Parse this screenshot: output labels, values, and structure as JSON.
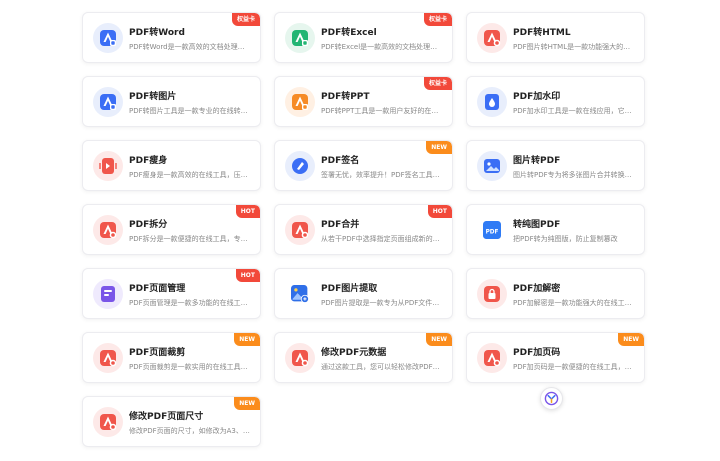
{
  "tools": [
    {
      "title": "PDF转Word",
      "desc": "PDF转Word是一款高效的文档处理…",
      "badge": "权益卡",
      "badge_color": "red",
      "icon": "pdf-to-word-icon",
      "bg": "#e8eefc",
      "fg": "#3b6ef5"
    },
    {
      "title": "PDF转Excel",
      "desc": "PDF转Excel是一款高效的文档处理…",
      "badge": "权益卡",
      "badge_color": "red",
      "icon": "pdf-to-excel-icon",
      "bg": "#e6f6ee",
      "fg": "#22b573"
    },
    {
      "title": "PDF转HTML",
      "desc": "PDF图片转HTML是一款功能强大的…",
      "badge": "",
      "badge_color": "",
      "icon": "pdf-to-html-icon",
      "bg": "#fde9e8",
      "fg": "#f0564b"
    },
    {
      "title": "PDF转图片",
      "desc": "PDF转图片工具是一款专业的在线转…",
      "badge": "",
      "badge_color": "",
      "icon": "pdf-to-image-icon",
      "bg": "#e8eefc",
      "fg": "#3b6ef5"
    },
    {
      "title": "PDF转PPT",
      "desc": "PDF转PPT工具是一款用户友好的在…",
      "badge": "权益卡",
      "badge_color": "red",
      "icon": "pdf-to-ppt-icon",
      "bg": "#fff0e3",
      "fg": "#f68b26"
    },
    {
      "title": "PDF加水印",
      "desc": "PDF加水印工具是一款在线应用，它…",
      "badge": "",
      "badge_color": "",
      "icon": "watermark-icon",
      "bg": "#e8eefc",
      "fg": "#3b6ef5"
    },
    {
      "title": "PDF瘦身",
      "desc": "PDF瘦身是一款高效的在线工具，压…",
      "badge": "",
      "badge_color": "",
      "icon": "compress-icon",
      "bg": "#fde9e8",
      "fg": "#f0564b"
    },
    {
      "title": "PDF签名",
      "desc": "签署无忧，效率提升！PDF签名工具…",
      "badge": "NEW",
      "badge_color": "orange",
      "icon": "signature-icon",
      "bg": "#e8eefc",
      "fg": "#3b6ef5"
    },
    {
      "title": "图片转PDF",
      "desc": "图片转PDF专为将多张图片合并转换…",
      "badge": "",
      "badge_color": "",
      "icon": "image-to-pdf-icon",
      "bg": "#e8eefc",
      "fg": "#3b6ef5"
    },
    {
      "title": "PDF拆分",
      "desc": "PDF拆分是一款便捷的在线工具，专…",
      "badge": "HOT",
      "badge_color": "red",
      "icon": "split-icon",
      "bg": "#fde9e8",
      "fg": "#f0564b"
    },
    {
      "title": "PDF合并",
      "desc": "从若干PDF中选择指定页面组成新的…",
      "badge": "HOT",
      "badge_color": "red",
      "icon": "merge-icon",
      "bg": "#fde9e8",
      "fg": "#f0564b"
    },
    {
      "title": "转纯图PDF",
      "desc": "把PDF转为纯图版，防止复制篡改",
      "badge": "",
      "badge_color": "",
      "icon": "pure-image-pdf-icon",
      "bg": "#ffffff",
      "fg": "#3b6ef5"
    },
    {
      "title": "PDF页面管理",
      "desc": "PDF页面管理是一款多功能的在线工…",
      "badge": "HOT",
      "badge_color": "red",
      "icon": "page-manage-icon",
      "bg": "#efeafd",
      "fg": "#7a55e8"
    },
    {
      "title": "PDF图片提取",
      "desc": "PDF图片提取是一款专为从PDF文件…",
      "badge": "",
      "badge_color": "",
      "icon": "image-extract-icon",
      "bg": "#ffffff",
      "fg": "#3b6ef5"
    },
    {
      "title": "PDF加解密",
      "desc": "PDF加解密是一款功能强大的在线工…",
      "badge": "",
      "badge_color": "",
      "icon": "lock-icon",
      "bg": "#fde9e8",
      "fg": "#f0564b"
    },
    {
      "title": "PDF页面裁剪",
      "desc": "PDF页面裁剪是一款实用的在线工具…",
      "badge": "NEW",
      "badge_color": "orange",
      "icon": "crop-icon",
      "bg": "#fde9e8",
      "fg": "#f0564b"
    },
    {
      "title": "修改PDF元数据",
      "desc": "通过这款工具，您可以轻松修改PDF…",
      "badge": "NEW",
      "badge_color": "orange",
      "icon": "metadata-icon",
      "bg": "#fde9e8",
      "fg": "#f0564b"
    },
    {
      "title": "PDF加页码",
      "desc": "PDF加页码是一款便捷的在线工具，…",
      "badge": "NEW",
      "badge_color": "orange",
      "icon": "page-number-icon",
      "bg": "#fde9e8",
      "fg": "#f0564b"
    },
    {
      "title": "修改PDF页面尺寸",
      "desc": "修改PDF页面的尺寸，如修改为A3、…",
      "badge": "NEW",
      "badge_color": "orange",
      "icon": "page-size-icon",
      "bg": "#fde9e8",
      "fg": "#f0564b"
    }
  ],
  "float_button": {
    "icon": "assistant-icon"
  }
}
